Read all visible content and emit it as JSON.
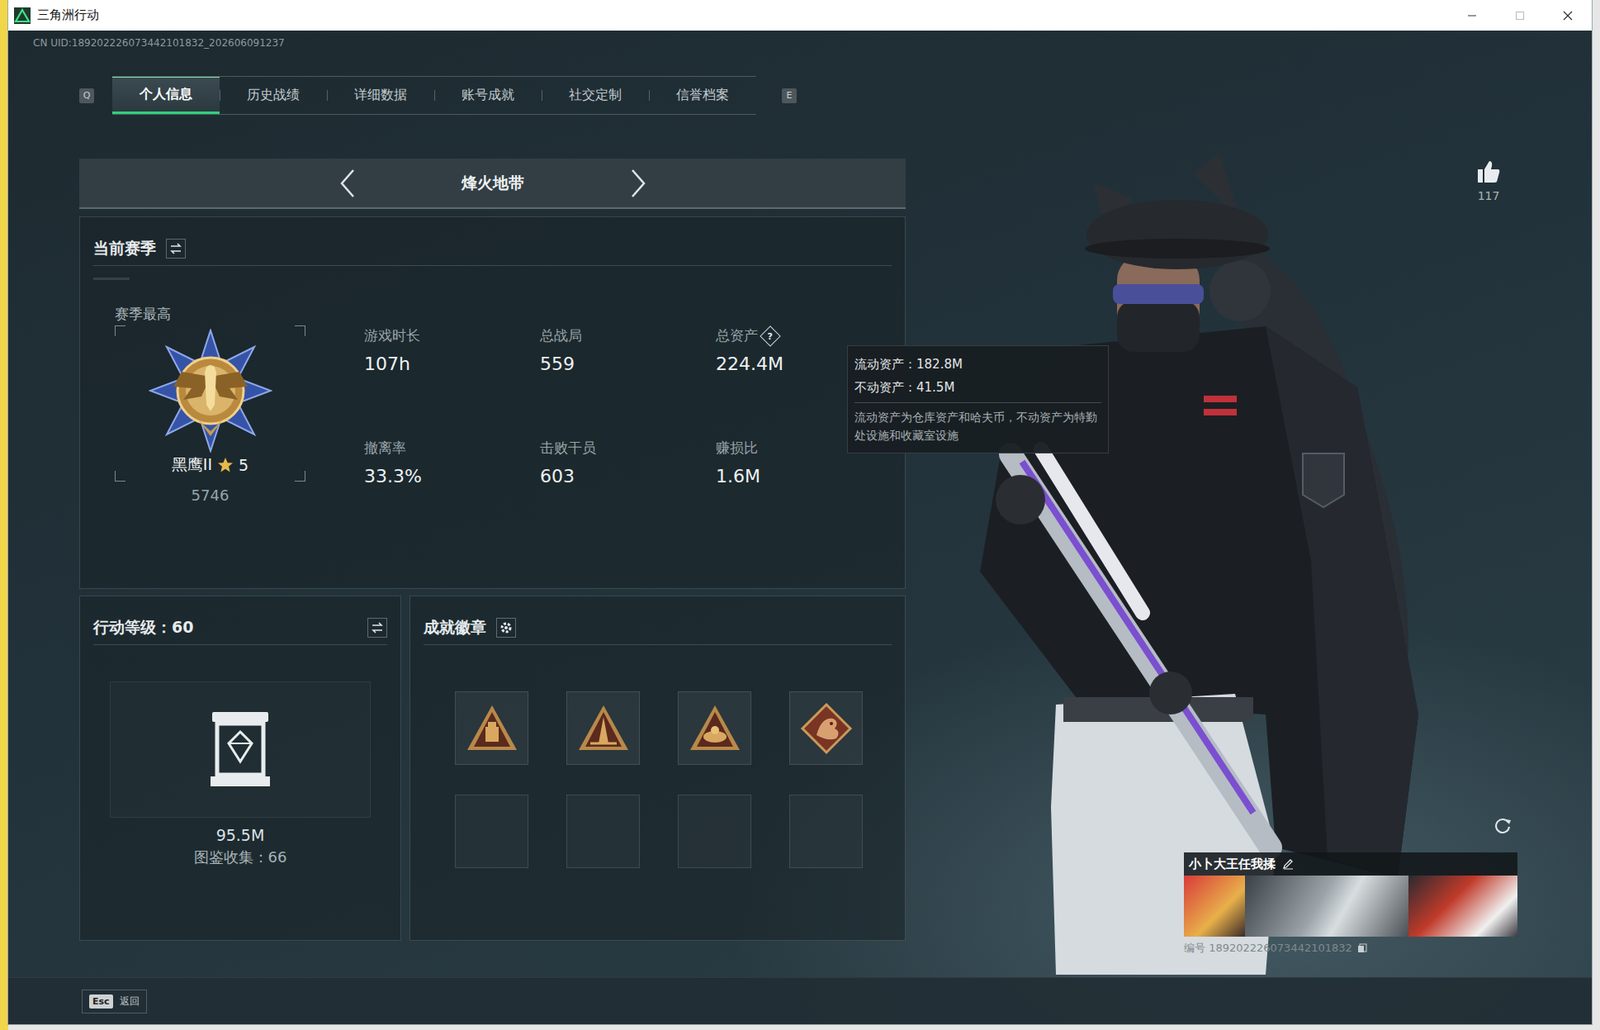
{
  "window": {
    "title": "三角洲行动"
  },
  "uid": "CN UID:189202226073442101832_202606091237",
  "tabs": {
    "prev_key": "Q",
    "next_key": "E",
    "items": [
      {
        "label": "个人信息",
        "selected": true
      },
      {
        "label": "历史战绩",
        "selected": false
      },
      {
        "label": "详细数据",
        "selected": false
      },
      {
        "label": "账号成就",
        "selected": false
      },
      {
        "label": "社交定制",
        "selected": false
      },
      {
        "label": "信誉档案",
        "selected": false
      }
    ]
  },
  "mode": {
    "title": "烽火地带"
  },
  "season": {
    "title": "当前赛季",
    "best_label": "赛季最高",
    "rank": "黑鹰II",
    "rank_stars": "5",
    "score": "5746"
  },
  "stats": [
    {
      "label": "游戏时长",
      "value": "107h",
      "kind": "plain"
    },
    {
      "label": "总战局",
      "value": "559",
      "kind": "plain"
    },
    {
      "label": "总资产",
      "value": "224.4M",
      "kind": "help",
      "help_icon": "?"
    },
    {
      "label": "撤离率",
      "value": "33.3%",
      "kind": "plain"
    },
    {
      "label": "击败干员",
      "value": "603",
      "kind": "plain"
    },
    {
      "label": "赚损比",
      "value": "1.6M",
      "kind": "plain"
    }
  ],
  "tooltip": {
    "rows": [
      "流动资产：182.8M",
      "不动资产：41.5M"
    ],
    "note": "流动资产为仓库资产和哈夫币，不动资产为特勤处设施和收藏室设施"
  },
  "level": {
    "title": "行动等级：60",
    "value": "95.5M",
    "collection": "图鉴收集：66"
  },
  "badges": {
    "title": "成就徽章",
    "slots": [
      {
        "filled": true
      },
      {
        "filled": true
      },
      {
        "filled": true
      },
      {
        "filled": true
      },
      {
        "filled": false
      },
      {
        "filled": false
      },
      {
        "filled": false
      },
      {
        "filled": false
      }
    ]
  },
  "likes": {
    "count": "117"
  },
  "player": {
    "name": "小卜大王任我揉",
    "id": "编号 189202226073442101832"
  },
  "footer": {
    "key": "Esc",
    "label": "返回"
  }
}
